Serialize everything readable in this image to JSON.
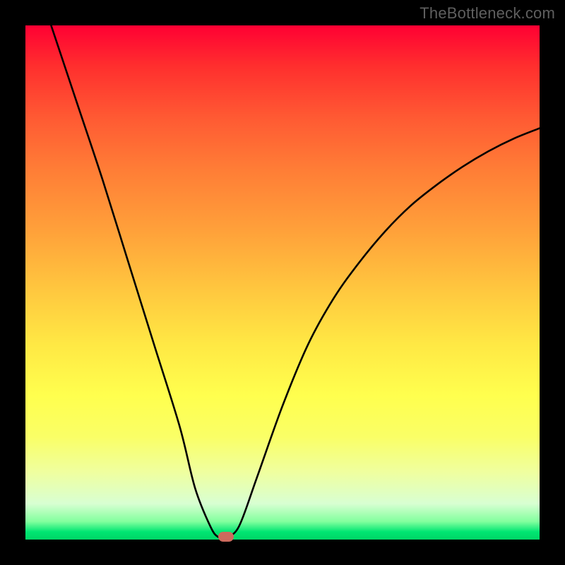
{
  "watermark": "TheBottleneck.com",
  "chart_data": {
    "type": "line",
    "title": "",
    "xlabel": "",
    "ylabel": "",
    "xlim": [
      0,
      100
    ],
    "ylim": [
      0,
      100
    ],
    "grid": false,
    "legend": false,
    "series": [
      {
        "name": "curve",
        "x": [
          5,
          10,
          15,
          20,
          25,
          30,
          33,
          36,
          37.5,
          39,
          41.5,
          45,
          50,
          55,
          60,
          65,
          70,
          75,
          80,
          85,
          90,
          95,
          100
        ],
        "y": [
          100,
          85,
          70,
          54,
          38,
          22,
          10,
          2.5,
          0.5,
          0.5,
          2.5,
          12,
          26,
          38,
          47,
          54,
          60,
          65,
          69,
          72.5,
          75.5,
          78,
          80
        ]
      }
    ],
    "marker": {
      "x": 39,
      "y": 0.5
    },
    "background_gradient": {
      "top_color": "#ff0033",
      "mid_color": "#ffe844",
      "bottom_color": "#00d666"
    },
    "curve_color": "#000000",
    "marker_color": "#cd6a5d"
  }
}
